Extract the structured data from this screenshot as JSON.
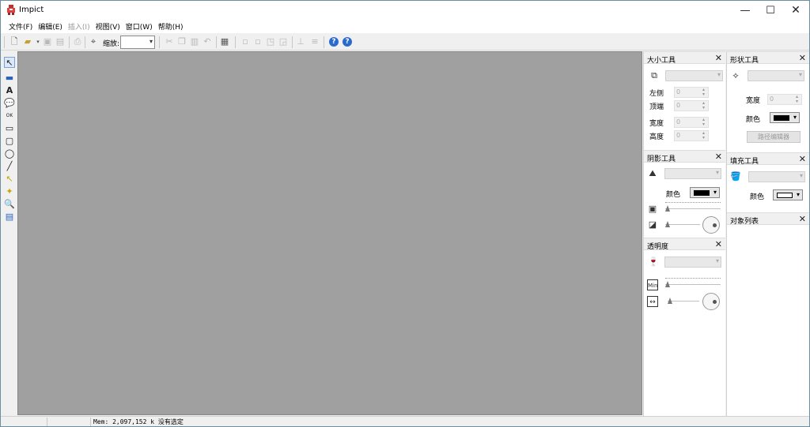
{
  "window": {
    "title": "Impict"
  },
  "menu": [
    {
      "label": "文件(F)",
      "enabled": true
    },
    {
      "label": "编辑(E)",
      "enabled": true
    },
    {
      "label": "插入(I)",
      "enabled": false
    },
    {
      "label": "视图(V)",
      "enabled": true
    },
    {
      "label": "窗口(W)",
      "enabled": true
    },
    {
      "label": "帮助(H)",
      "enabled": true
    }
  ],
  "toolbar": {
    "zoom_label": "缩放:",
    "zoom_value": ""
  },
  "panels": {
    "size": {
      "title": "大小工具",
      "left_label": "左侧",
      "left_value": "0",
      "top_label": "顶端",
      "top_value": "0",
      "width_label": "宽度",
      "width_value": "0",
      "height_label": "高度",
      "height_value": "0"
    },
    "shape": {
      "title": "形状工具",
      "width_label": "宽度",
      "width_value": "0",
      "color_label": "颜色",
      "color": "#000000",
      "editor_button": "路径编辑器"
    },
    "shadow": {
      "title": "阴影工具",
      "color_label": "颜色",
      "color": "#000000"
    },
    "fill": {
      "title": "填充工具",
      "color_label": "颜色",
      "color": "#ffffff"
    },
    "transparency": {
      "title": "透明度"
    },
    "objects": {
      "title": "对象列表"
    }
  },
  "status": {
    "memory_text": "Mem: 2,097,152 k",
    "selection_text": "没有选定"
  },
  "colors": {
    "canvas": "#a0a0a0",
    "chrome": "#f0f0f0"
  }
}
